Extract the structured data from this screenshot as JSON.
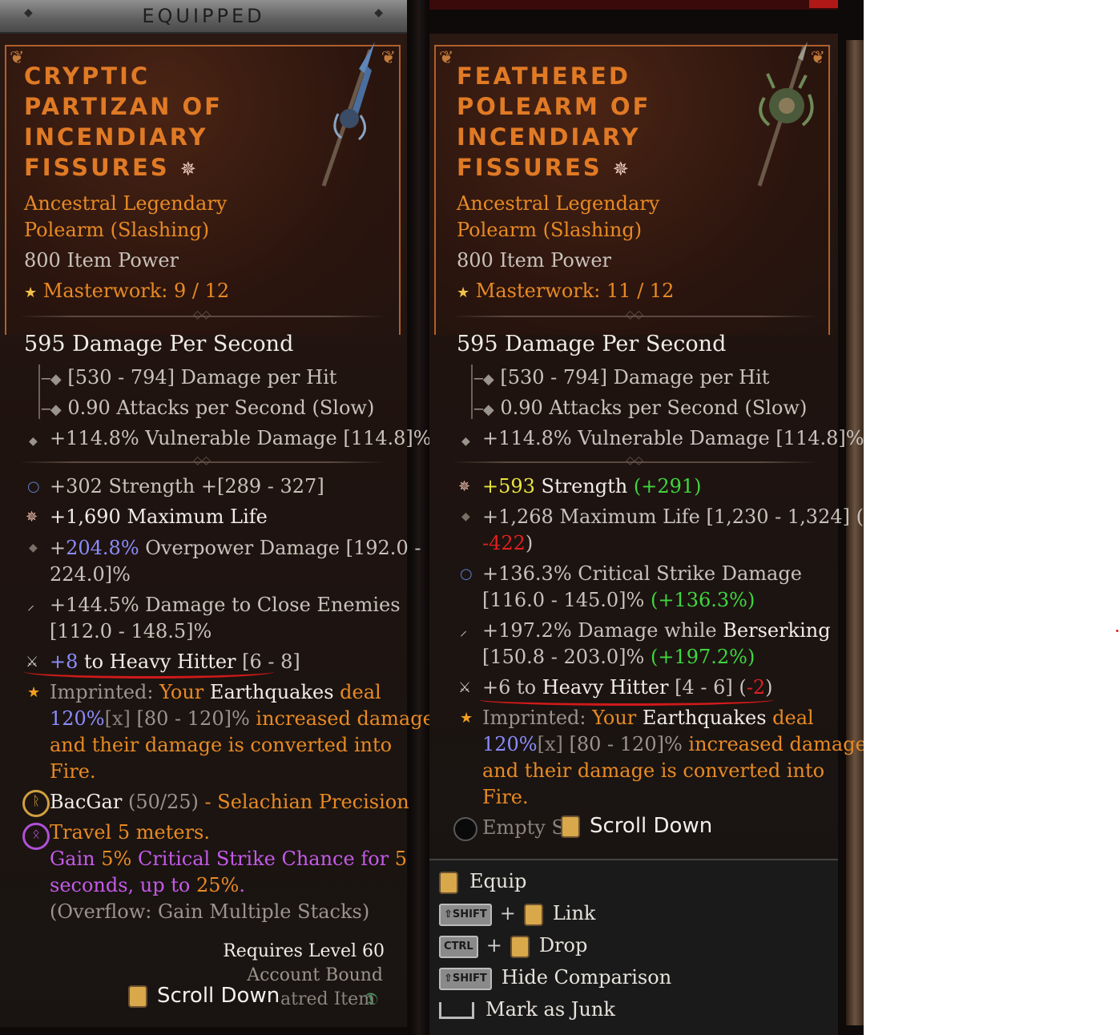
{
  "header": {
    "equipped_label": "EQUIPPED"
  },
  "equipped": {
    "title_lines": [
      "CRYPTIC",
      "PARTIZAN OF",
      "INCENDIARY",
      "FISSURES"
    ],
    "rarity_lines": [
      "Ancestral Legendary",
      "Polearm (Slashing)"
    ],
    "item_power": "800 Item Power",
    "masterwork": "Masterwork: 9 / 12",
    "dps": "595 Damage Per Second",
    "damage_per_hit": "[530 - 794] Damage per Hit",
    "attacks_per_second": "0.90 Attacks per Second (Slow)",
    "vulnerable": "+114.8% Vulnerable Damage [114.8]%",
    "affixes": {
      "strength": "+302 Strength +[289 - 327]",
      "max_life": "+1,690 Maximum Life",
      "overpower_prefix": "+",
      "overpower_value": "204.8%",
      "overpower_rest": " Overpower Damage [192.0 -",
      "overpower_line2": "224.0]%",
      "close_enemies_1": "+144.5% Damage to Close Enemies",
      "close_enemies_2": "[112.0 - 148.5]%",
      "heavy_hitter_value": "+8",
      "heavy_hitter_to": " to ",
      "heavy_hitter_name": "Heavy Hitter",
      "heavy_hitter_range": " [6 - 8]"
    },
    "aspect": {
      "imprinted": "Imprinted:",
      "your": " Your ",
      "earthquakes": "Earthquakes",
      "deal": " deal",
      "pct": "120%",
      "x": "[x]",
      "range": " [80 - 120]%",
      "increased": " increased damage",
      "line3": "and their damage is converted into",
      "line4": "Fire."
    },
    "gem": {
      "name": "BacGar",
      "count": " (50/25)",
      "dash": " - ",
      "bonus": "Selachian Precision",
      "travel": "Travel 5 meters.",
      "gain_1": "Gain ",
      "gain_pct": "5%",
      "gain_2": " Critical Strike Chance for ",
      "gain_sec": "5",
      "gain_line2a": "seconds, up to ",
      "gain_line2b": "25%",
      "gain_line2c": ".",
      "overflow": "(Overflow: Gain Multiple Stacks)"
    },
    "requires": "Requires Level 60",
    "account_bound": "Account Bound",
    "tempered": "atred Item",
    "scroll": "Scroll Down"
  },
  "compared": {
    "title_lines": [
      "FEATHERED",
      "POLEARM OF",
      "INCENDIARY",
      "FISSURES"
    ],
    "rarity_lines": [
      "Ancestral Legendary",
      "Polearm (Slashing)"
    ],
    "item_power": "800 Item Power",
    "masterwork": "Masterwork: 11 / 12",
    "dps": "595 Damage Per Second",
    "damage_per_hit": "[530 - 794] Damage per Hit",
    "attacks_per_second": "0.90 Attacks per Second (Slow)",
    "vulnerable": "+114.8% Vulnerable Damage [114.8]%",
    "affixes": {
      "strength_value": "+593",
      "strength_name": " Strength ",
      "strength_diff": "(+291)",
      "life_1": "+1,268 Maximum Life [1,230 - 1,324] (",
      "life_diff": "-422",
      "life_close": ")",
      "crit_1": "+136.3% Critical Strike Damage",
      "crit_2": "[116.0 - 145.0]% ",
      "crit_diff": "(+136.3%)",
      "berserk_1": "+197.2% Damage while ",
      "berserk_name": "Berserking",
      "berserk_2": "[150.8 - 203.0]% ",
      "berserk_diff": "(+197.2%)",
      "heavy_1": "+6 to ",
      "heavy_name": "Heavy Hitter",
      "heavy_range": " [4 - 6] (",
      "heavy_diff": "-2",
      "heavy_close": ")"
    },
    "aspect": {
      "imprinted": "Imprinted:",
      "your": " Your ",
      "earthquakes": "Earthquakes",
      "deal": " deal",
      "pct": "120%",
      "x": "[x]",
      "range": " [80 - 120]%",
      "increased": " increased damage",
      "line3": "and their damage is converted into",
      "line4": "Fire."
    },
    "empty_socket": "Empty S",
    "scroll": "Scroll Down"
  },
  "actions": {
    "equip": "Equip",
    "shift_key": "SHIFT",
    "ctrl_key": "CTRL",
    "plus": "+",
    "link": "Link",
    "drop": "Drop",
    "hide_comparison": "Hide Comparison",
    "mark_junk": "Mark as Junk"
  }
}
